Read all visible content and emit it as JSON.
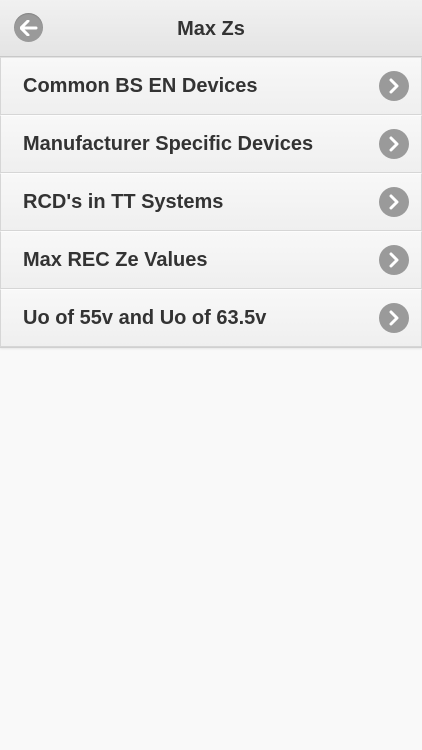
{
  "header": {
    "title": "Max Zs",
    "back_icon": "arrow-left-icon"
  },
  "menu": {
    "items": [
      {
        "label": "Common BS EN Devices",
        "icon": "chevron-right-icon"
      },
      {
        "label": "Manufacturer Specific Devices",
        "icon": "chevron-right-icon"
      },
      {
        "label": "RCD's in TT Systems",
        "icon": "chevron-right-icon"
      },
      {
        "label": "Max REC Ze Values",
        "icon": "chevron-right-icon"
      },
      {
        "label": "Uo of 55v and Uo of 63.5v",
        "icon": "chevron-right-icon"
      }
    ]
  },
  "colors": {
    "background": "#f9f9f9",
    "text": "#333333",
    "icon_circle": "#9a9a9a"
  }
}
